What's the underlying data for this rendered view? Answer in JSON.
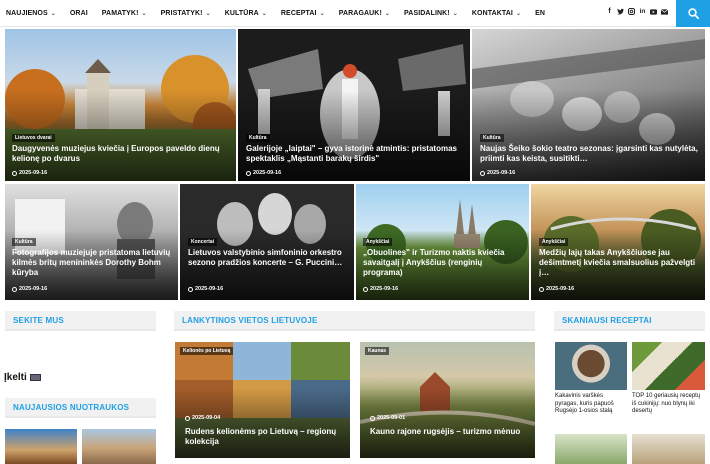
{
  "nav": {
    "items": [
      {
        "label": "NAUJIENOS",
        "has_dropdown": true
      },
      {
        "label": "ORAI",
        "has_dropdown": false
      },
      {
        "label": "PAMATYK!",
        "has_dropdown": true
      },
      {
        "label": "PRISTATYK!",
        "has_dropdown": true
      },
      {
        "label": "KULTŪRA",
        "has_dropdown": true
      },
      {
        "label": "RECEPTAI",
        "has_dropdown": true
      },
      {
        "label": "PARAGAUK!",
        "has_dropdown": true
      },
      {
        "label": "PASIDALINK!",
        "has_dropdown": true
      },
      {
        "label": "KONTAKTAI",
        "has_dropdown": true
      },
      {
        "label": "EN",
        "has_dropdown": false
      }
    ],
    "social_icons": [
      "facebook-icon",
      "twitter-icon",
      "instagram-icon",
      "linkedin-icon",
      "youtube-icon",
      "mail-icon"
    ],
    "search_icon": "search-icon",
    "accent": "#1fa0e5"
  },
  "featured_top": [
    {
      "category": "Lietuvos dvarai",
      "title": "Daugyvenės muziejus kviečia į Europos paveldo dienų kelionę po dvarus",
      "date": "2025-09-16"
    },
    {
      "category": "Kultūra",
      "title": "Galerijoje „laiptai\" – gyva istorinė atmintis: pristatomas spektaklis „Mąstanti barakų širdis\"",
      "date": "2025-09-16"
    },
    {
      "category": "Kultūra",
      "title": "Naujas Šeiko šokio teatro sezonas: įgarsinti kas nutylėta, priimti kas keista, susitikti…",
      "date": "2025-09-16"
    }
  ],
  "featured_row2": [
    {
      "category": "Kultūra",
      "title": "Fotografijos muziejuje pristatoma lietuvių kilmės britų menininkės Dorothy Bohm kūryba",
      "date": "2025-09-16"
    },
    {
      "category": "Koncertai",
      "title": "Lietuvos valstybinio simfoninio orkestro sezono pradžios koncerte – G. Puccini…",
      "date": "2025-09-16"
    },
    {
      "category": "Anykščiai",
      "title": "„Obuolines\" ir Turizmo naktis kviečia savaitgalį į Anykščius (renginių programa)",
      "date": "2025-09-16"
    },
    {
      "category": "Anykščiai",
      "title": "Medžių lajų takas Anykščiuose jau dešimtmetį kviečia smalsuolius pažvelgti į…",
      "date": "2025-09-16"
    }
  ],
  "sidebar_left": {
    "follow_heading": "SEKITE MUS",
    "upload_label": "Įkelti",
    "photos_heading": "NAUJAUSIOS NUOTRAUKOS"
  },
  "places": {
    "heading": "LANKYTINOS VIETOS LIETUVOJE",
    "items": [
      {
        "category": "Kelionės po Lietuvą",
        "title": "Rudens kelionėms po Lietuvą – regionų kolekcija",
        "date": "2025-09-04"
      },
      {
        "category": "Kaunas",
        "title": "Kauno rajone rugsėjis – turizmo mėnuo",
        "date": "2025-09-01"
      }
    ]
  },
  "recipes": {
    "heading": "SKANIAUSI RECEPTAI",
    "items": [
      {
        "title": "Kakavinis varškės pyragas, kuris papuoš Rugsėjo 1-osios stalą"
      },
      {
        "title": "TOP 10 geriausių receptų iš cukinijų: nuo blynų iki desertų"
      }
    ]
  }
}
